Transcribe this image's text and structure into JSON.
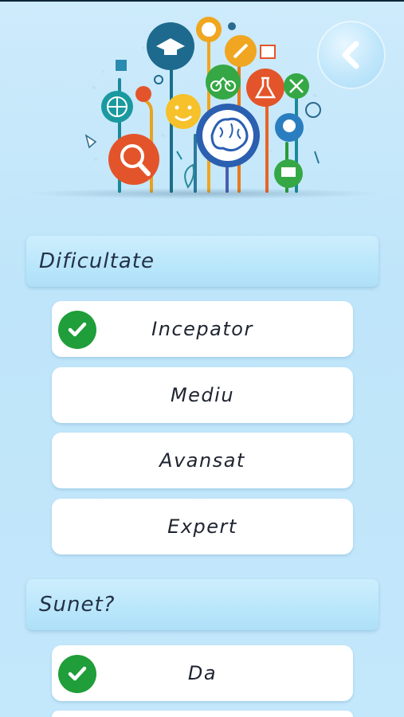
{
  "header": {
    "back_icon": "chevron-left-icon"
  },
  "illustration": {
    "icon": "education-tree-illustration"
  },
  "difficulty": {
    "title": "Dificultate",
    "options": [
      {
        "label": "Incepator",
        "selected": true
      },
      {
        "label": "Mediu",
        "selected": false
      },
      {
        "label": "Avansat",
        "selected": false
      },
      {
        "label": "Expert",
        "selected": false
      }
    ]
  },
  "sound": {
    "title": "Sunet?",
    "options": [
      {
        "label": "Da",
        "selected": true
      }
    ]
  },
  "colors": {
    "check": "#1f9e3a",
    "header_text": "#233247",
    "background": "#c3e7fb"
  }
}
